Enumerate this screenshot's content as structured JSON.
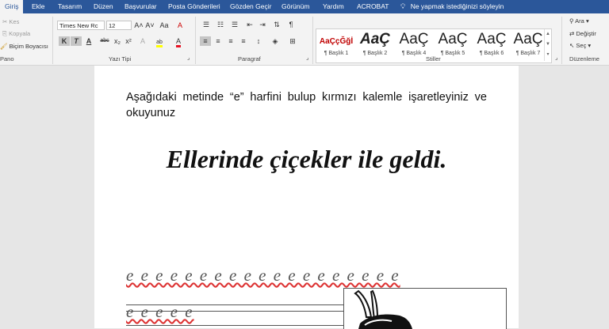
{
  "tabs": [
    "Giriş",
    "Ekle",
    "Tasarım",
    "Düzen",
    "Başvurular",
    "Posta Gönderileri",
    "Gözden Geçir",
    "Görünüm",
    "Yardım",
    "ACROBAT"
  ],
  "tell_me": "Ne yapmak istediğinizi söyleyin",
  "clipboard": {
    "cut": "Kes",
    "copy": "Kopyala",
    "format_painter": "Biçim Boyacısı",
    "label": "Pano"
  },
  "font": {
    "name": "Times New Rc",
    "size": "12",
    "label": "Yazı Tipi",
    "bold": "K",
    "italic": "T",
    "underline": "A",
    "strike": "abc",
    "sub": "x₂",
    "sup": "x²",
    "grow": "A˄",
    "shrink": "A˅",
    "case": "Aa",
    "clear": "A",
    "highlight": "ab",
    "color": "A"
  },
  "paragraph": {
    "label": "Paragraf"
  },
  "styles": {
    "label": "Stiller",
    "items": [
      {
        "preview": "AaÇçĞğİ",
        "name": "¶ Başlık 1"
      },
      {
        "preview": "AaÇ",
        "name": "¶ Başlık 2"
      },
      {
        "preview": "AaÇ",
        "name": "¶ Başlık 4"
      },
      {
        "preview": "AaÇ",
        "name": "¶ Başlık 5"
      },
      {
        "preview": "AaÇ",
        "name": "¶ Başlık 6"
      },
      {
        "preview": "AaÇ",
        "name": "¶ Başlık 7"
      }
    ]
  },
  "editing": {
    "find": "Ara",
    "replace": "Değiştir",
    "select": "Seç",
    "label": "Düzenleme"
  },
  "document": {
    "instruction": "Aşağıdaki metinde “e” harfini bulup kırmızı kalemle işaretleyiniz ve okuyunuz",
    "sentence": "Ellerinde çiçekler ile geldi.",
    "e_row_1": "e e e e e e e e e e e e e e e e e e e",
    "e_row_2": "e e e e e"
  },
  "colors": {
    "accent": "#2b579a",
    "highlight": "#ffff00",
    "font_color": "#e81123"
  }
}
